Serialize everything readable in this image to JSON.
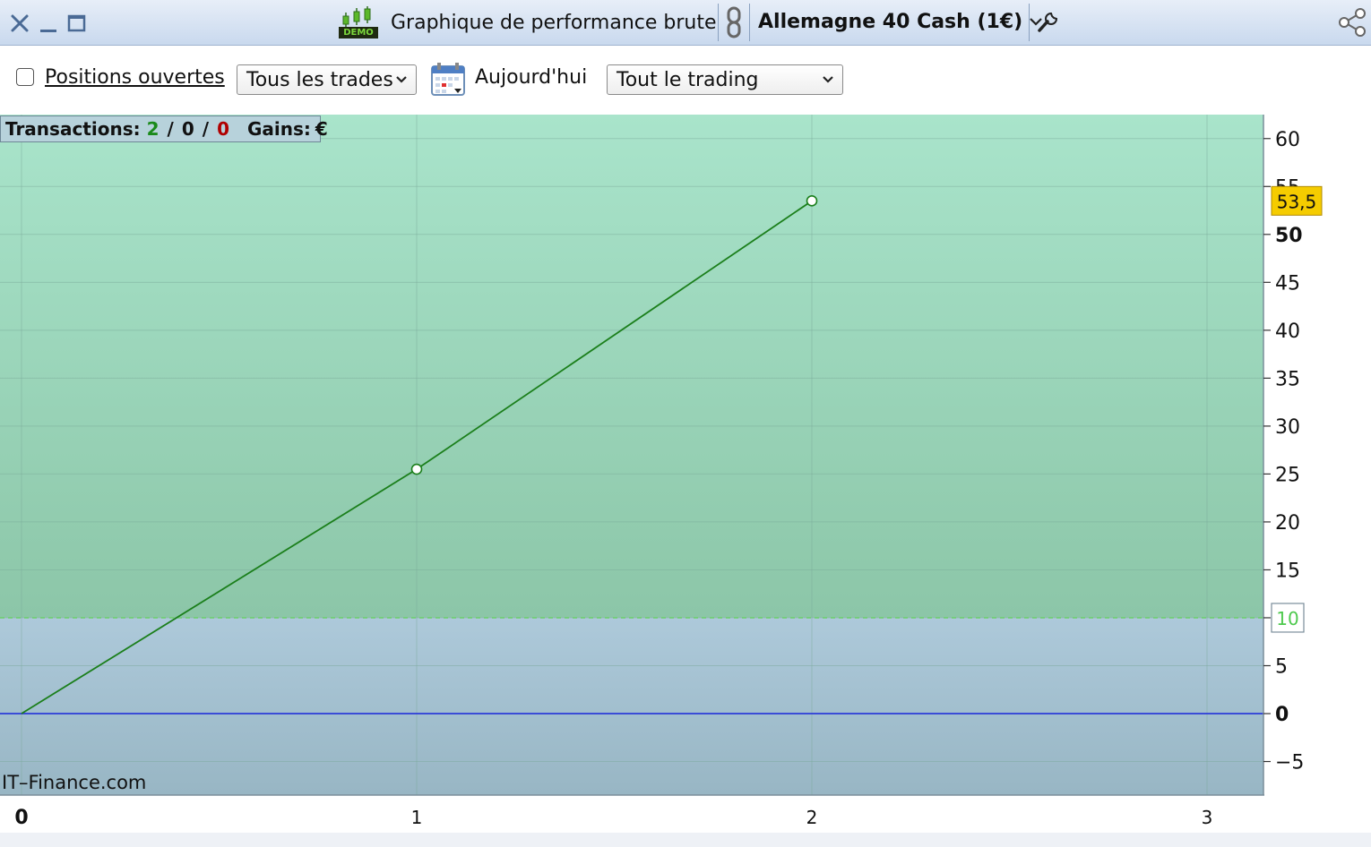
{
  "titlebar": {
    "demo_badge": "DEMO",
    "title": "Graphique de performance brute",
    "instrument": "Allemagne 40 Cash (1€)"
  },
  "toolbar": {
    "open_positions_label": "Positions ouvertes",
    "open_positions_checked": false,
    "trades_filter": "Tous les trades",
    "period_label": "Aujourd'hui",
    "scope_filter": "Tout le trading"
  },
  "stats": {
    "transactions_label": "Transactions:",
    "wins": "2",
    "sep1": "/",
    "neutral": "0",
    "sep2": "/",
    "losses": "0",
    "gains_label": "Gains:",
    "gains_value": "€"
  },
  "watermark": "IT–Finance.com",
  "colors": {
    "line": "#1b7f1b",
    "positive_zone": "#a8e2c9",
    "target_zone": "#a9c7d8",
    "zero_line": "#2b3bd8",
    "win": "#1a8a1a",
    "loss": "#b00000",
    "value_badge": "#f5cc00"
  },
  "icons": [
    "close-icon",
    "minimize-icon",
    "maximize-icon",
    "demo-chart-icon",
    "link-icon",
    "chevron-down-icon",
    "wrench-icon",
    "share-icon",
    "calendar-icon"
  ],
  "chart_data": {
    "type": "line",
    "x": [
      0,
      1,
      2
    ],
    "values": [
      0,
      25.5,
      53.5
    ],
    "xlim": [
      0,
      3.15
    ],
    "ylim": [
      -8.5,
      62.5
    ],
    "x_ticks": [
      "0",
      "1",
      "2",
      "3"
    ],
    "y_ticks": [
      "-5",
      "0",
      "5",
      "10",
      "15",
      "20",
      "25",
      "30",
      "35",
      "40",
      "45",
      "50",
      "55",
      "60"
    ],
    "last_value_label": "53,5",
    "threshold": 10,
    "threshold_label": "10",
    "grid": true
  }
}
